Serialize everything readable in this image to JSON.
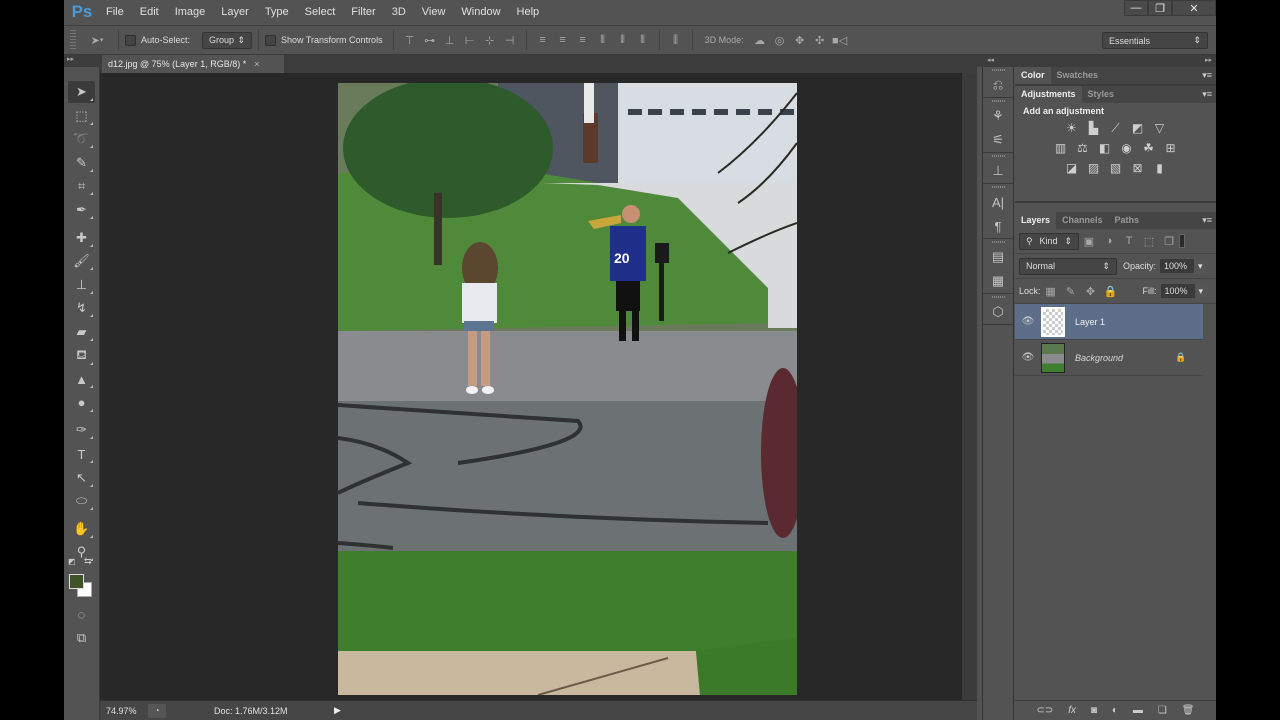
{
  "app": {
    "logo": "Ps",
    "menu": [
      "File",
      "Edit",
      "Image",
      "Layer",
      "Type",
      "Select",
      "Filter",
      "3D",
      "View",
      "Window",
      "Help"
    ],
    "window_controls": {
      "minimize": "—",
      "restore": "❐",
      "close": "✕"
    }
  },
  "options_bar": {
    "auto_select_label": "Auto-Select:",
    "auto_select_checked": false,
    "auto_select_target": "Group",
    "show_transform_label": "Show Transform Controls",
    "show_transform_checked": false,
    "mode_3d_label": "3D Mode:",
    "workspace": "Essentials"
  },
  "document": {
    "tab_title": "d12.jpg @ 75% (Layer 1, RGB/8) *",
    "close_glyph": "×",
    "zoom": "74.97%",
    "doc_size": "Doc: 1.76M/3.12M"
  },
  "tools": [
    {
      "name": "move-tool",
      "glyph": "➤"
    },
    {
      "name": "marquee-tool",
      "glyph": "⬚"
    },
    {
      "name": "lasso-tool",
      "glyph": "➰"
    },
    {
      "name": "quick-selection-tool",
      "glyph": "✎"
    },
    {
      "name": "crop-tool",
      "glyph": "⌗"
    },
    {
      "name": "eyedropper-tool",
      "glyph": "✒"
    },
    {
      "name": "healing-brush-tool",
      "glyph": "✚"
    },
    {
      "name": "brush-tool",
      "glyph": "🖌"
    },
    {
      "name": "clone-stamp-tool",
      "glyph": "⊥"
    },
    {
      "name": "history-brush-tool",
      "glyph": "↯"
    },
    {
      "name": "eraser-tool",
      "glyph": "▰"
    },
    {
      "name": "paint-bucket-tool",
      "glyph": "⛾"
    },
    {
      "name": "blur-tool",
      "glyph": "▲"
    },
    {
      "name": "dodge-tool",
      "glyph": "●"
    },
    {
      "name": "pen-tool",
      "glyph": "✑"
    },
    {
      "name": "type-tool",
      "glyph": "T"
    },
    {
      "name": "path-selection-tool",
      "glyph": "↖"
    },
    {
      "name": "ellipse-tool",
      "glyph": "⬭"
    },
    {
      "name": "hand-tool",
      "glyph": "✋"
    },
    {
      "name": "zoom-tool",
      "glyph": "⚲"
    }
  ],
  "colors": {
    "foreground": "#3f5228",
    "background": "#ffffff",
    "layer_selected": "#5c6e88",
    "ps_blue": "#4a9ad9"
  },
  "panels": {
    "color_tabs": [
      "Color",
      "Swatches"
    ],
    "adjust_tabs": [
      "Adjustments",
      "Styles"
    ],
    "adjust_heading": "Add an adjustment",
    "adjust_icons": [
      [
        "brightness-contrast",
        "levels",
        "curves",
        "exposure",
        "vibrance"
      ],
      [
        "hue-saturation",
        "color-balance",
        "black-white",
        "photo-filter",
        "channel-mixer",
        "color-lookup"
      ],
      [
        "invert",
        "posterize",
        "threshold",
        "selective-color",
        "gradient-map"
      ]
    ],
    "layers_tabs": [
      "Layers",
      "Channels",
      "Paths"
    ],
    "filter_kind": "Kind",
    "blend_mode": "Normal",
    "opacity_label": "Opacity:",
    "opacity": "100%",
    "lock_label": "Lock:",
    "fill_label": "Fill:",
    "fill": "100%",
    "layers": [
      {
        "name": "Layer 1",
        "selected": true,
        "visible": true,
        "locked": false
      },
      {
        "name": "Background",
        "selected": false,
        "visible": true,
        "locked": true
      }
    ]
  }
}
